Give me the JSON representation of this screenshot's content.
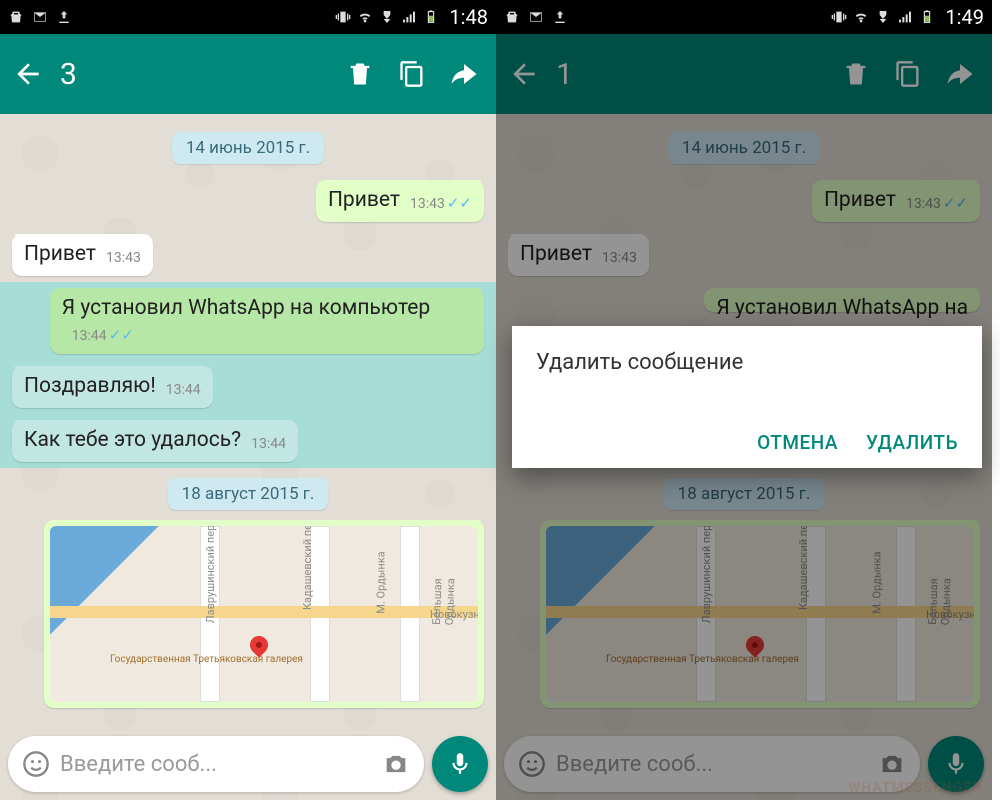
{
  "left": {
    "statusbar": {
      "time": "1:48"
    },
    "appbar": {
      "selected_count": "3"
    },
    "dates": {
      "d1": "14 июнь 2015 г.",
      "d2": "18 август 2015 г."
    },
    "messages": {
      "m1": {
        "text": "Привет",
        "time": "13:43"
      },
      "m2": {
        "text": "Привет",
        "time": "13:43"
      },
      "m3": {
        "text": "Я установил WhatsApp на компьютер",
        "time": "13:44"
      },
      "m4": {
        "text": "Поздравляю!",
        "time": "13:44"
      },
      "m5": {
        "text": "Как тебе это удалось?",
        "time": "13:44"
      }
    },
    "composer": {
      "placeholder": "Введите сооб..."
    },
    "map_labels": {
      "a": "Лаврушинский пер.",
      "b": "Кадашевский пер.",
      "c": "М. Ордынка",
      "d": "Большая Ордынка",
      "e": "Новокузнецкая",
      "poi": "Государственная Третьяковская галерея"
    }
  },
  "right": {
    "statusbar": {
      "time": "1:49"
    },
    "appbar": {
      "selected_count": "1"
    },
    "dates": {
      "d1": "14 июнь 2015 г.",
      "d2": "18 август 2015 г."
    },
    "messages": {
      "m1": {
        "text": "Привет",
        "time": "13:43"
      },
      "m2": {
        "text": "Привет",
        "time": "13:43"
      },
      "m3_partial": {
        "text": "Я установил WhatsApp на"
      }
    },
    "dialog": {
      "title": "Удалить сообщение",
      "cancel": "ОТМЕНА",
      "confirm": "УДАЛИТЬ"
    },
    "composer": {
      "placeholder": "Введите сооб..."
    },
    "watermark": "WHATMESSENGER"
  }
}
